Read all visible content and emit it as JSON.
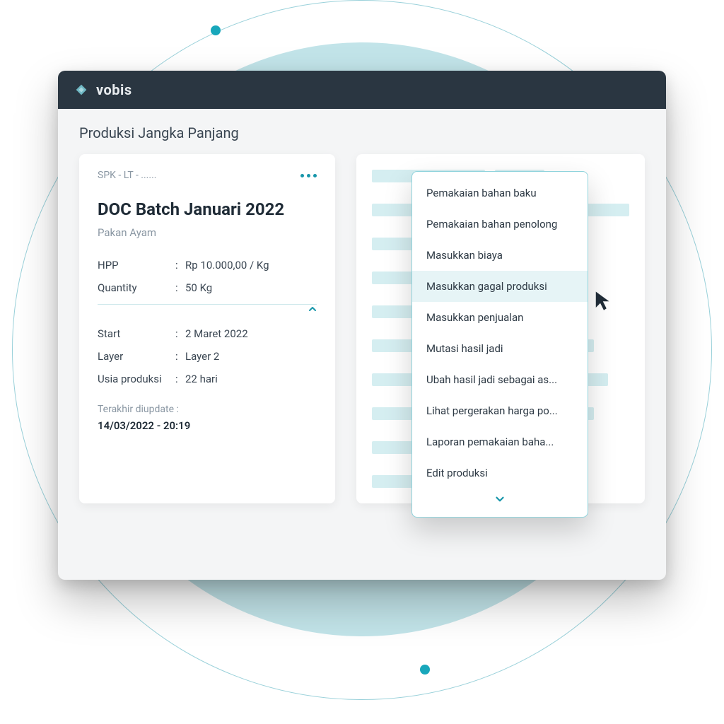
{
  "brand": "vobis",
  "page_title": "Produksi Jangka Panjang",
  "card": {
    "id_label": "SPK - LT - ......",
    "title": "DOC Batch Januari 2022",
    "subtitle": "Pakan Ayam",
    "rows1": [
      {
        "k": "HPP",
        "v": "Rp 10.000,00 / Kg"
      },
      {
        "k": "Quantity",
        "v": "50 Kg"
      }
    ],
    "rows2": [
      {
        "k": "Start",
        "v": "2 Maret 2022"
      },
      {
        "k": "Layer",
        "v": "Layer 2"
      },
      {
        "k": "Usia produksi",
        "v": "22 hari"
      }
    ],
    "updated_label": "Terakhir diupdate :",
    "updated_value": "14/03/2022 - 20:19"
  },
  "menu": {
    "items": [
      "Pemakaian bahan baku",
      "Pemakaian bahan penolong",
      "Masukkan biaya",
      "Masukkan gagal produksi",
      "Masukkan penjualan",
      "Mutasi hasil jadi",
      "Ubah hasil jadi sebagai as...",
      "Lihat pergerakan harga po...",
      "Laporan pemakaian baha...",
      "Edit produksi"
    ],
    "selected_index": 3
  },
  "colors": {
    "accent": "#1796aa",
    "header": "#2a3641",
    "bg_circle": "#c2e4e9"
  }
}
